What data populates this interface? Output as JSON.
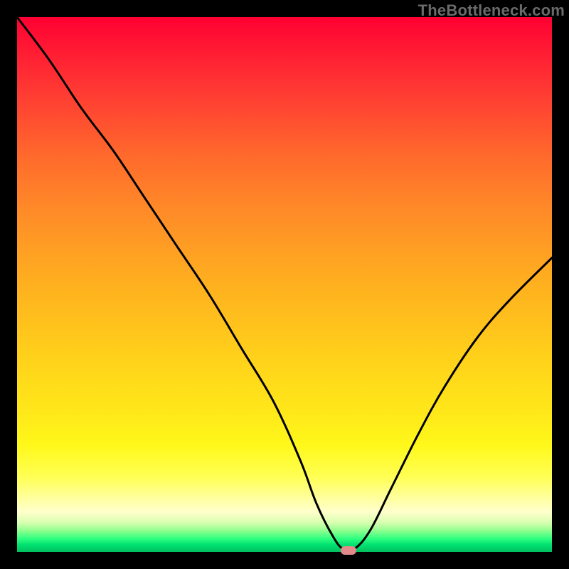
{
  "watermark": "TheBottleneck.com",
  "chart_data": {
    "type": "line",
    "title": "",
    "xlabel": "",
    "ylabel": "",
    "xlim": [
      0,
      100
    ],
    "ylim": [
      0,
      100
    ],
    "x": [
      0,
      6,
      12,
      18,
      24,
      30,
      36,
      42,
      48,
      53,
      56,
      59,
      61,
      63,
      66,
      70,
      75,
      80,
      86,
      92,
      100
    ],
    "values": [
      100,
      92,
      83,
      75,
      66,
      57,
      48,
      38,
      28,
      17,
      9,
      3,
      0.5,
      0.5,
      4,
      12,
      22,
      31,
      40,
      47,
      55
    ],
    "marker": {
      "x": 62,
      "y": 0
    },
    "gradient_stops": [
      {
        "pct": 0,
        "color": "#ff0033"
      },
      {
        "pct": 50,
        "color": "#ffb01f"
      },
      {
        "pct": 80,
        "color": "#fff81a"
      },
      {
        "pct": 100,
        "color": "#00c060"
      }
    ]
  }
}
